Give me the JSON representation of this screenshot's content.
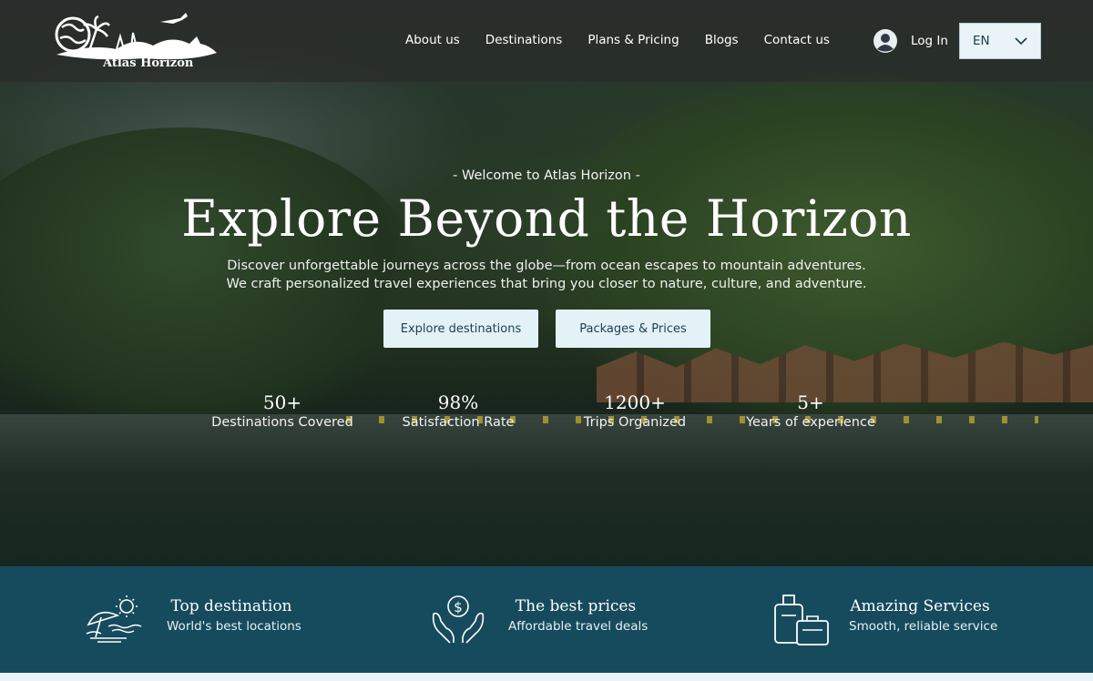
{
  "brand": {
    "name": "Atlas Horizon"
  },
  "nav": {
    "items": [
      "About us",
      "Destinations",
      "Plans & Pricing",
      "Blogs",
      "Contact us"
    ]
  },
  "auth": {
    "login_label": "Log In",
    "icon": "user-avatar-icon"
  },
  "language": {
    "selected": "EN",
    "icon": "chevron-down-icon"
  },
  "hero": {
    "welcome": "- Welcome to Atlas Horizon -",
    "title": "Explore Beyond the Horizon",
    "description": "Discover unforgettable journeys across the globe—from ocean escapes to mountain adventures. We craft personalized travel experiences that bring you closer to nature, culture, and adventure.",
    "buttons": {
      "explore": "Explore destinations",
      "packages": "Packages & Prices"
    }
  },
  "stats": [
    {
      "value": "50+",
      "label": "Destinations Covered"
    },
    {
      "value": "98%",
      "label": "Satisfaction Rate"
    },
    {
      "value": "1200+",
      "label": "Trips Organized"
    },
    {
      "value": "5+",
      "label": "Years of experience"
    }
  ],
  "features": [
    {
      "title": "Top destination",
      "subtitle": "World's best locations",
      "icon": "beach-umbrella-sun-icon"
    },
    {
      "title": "The best prices",
      "subtitle": "Affordable travel deals",
      "icon": "hands-dollar-coin-icon"
    },
    {
      "title": "Amazing Services",
      "subtitle": "Smooth, reliable service",
      "icon": "luggage-icon"
    }
  ],
  "colors": {
    "features_bg": "#164b5e",
    "button_bg": "#e3f2f7",
    "header_bg": "#2a2a2a"
  }
}
